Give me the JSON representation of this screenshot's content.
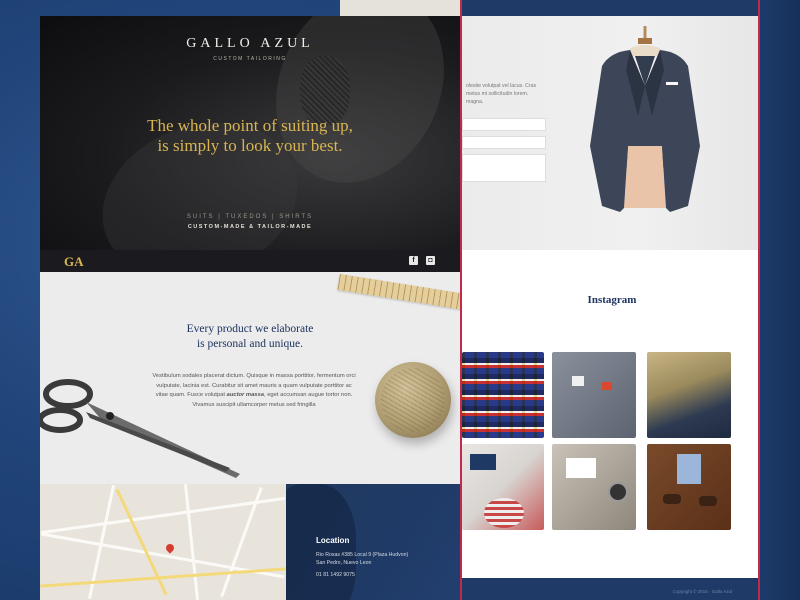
{
  "hero": {
    "brand": "GALLO AZUL",
    "brand_sub": "CUSTOM TAILORING",
    "headline_1": "The whole point of suiting up,",
    "headline_2": "is simply to look your best.",
    "tags": "SUITS  |  TUXEDOS  |  SHIRTS",
    "tags_2": "CUSTOM-MADE & TAILOR-MADE"
  },
  "navbar": {
    "logo": "GA",
    "facebook": "f",
    "instagram": "◘"
  },
  "product": {
    "title_1": "Every product we elaborate",
    "title_2": "is personal and unique.",
    "body_1": "Vestibulum sodales placerat dictum. Quisque in massa porttitor, fermentum orci",
    "body_2": "vulputate, lacinia est. Curabitur sit amet mauris a quam vulputate porttitor ac",
    "body_3a": "vitae quam. Fusce volutpat ",
    "body_3b": "auctor massa",
    "body_3c": ", eget accumsan augue tortor non.",
    "body_4": "Vivamus suscipit ullamcorper metus sed fringilla"
  },
  "location": {
    "title": "Location",
    "address_1": "Rio Rosas #385 Local 9 (Plaza Hudvon)",
    "address_2": "San Pedro, Nuevo Leon",
    "phone": "01 81 1492 9075"
  },
  "contact": {
    "text_1": "olestie volutpat vel lacus. Cras",
    "text_2": "metus mi sollicitudin lorem.",
    "text_3": "magna."
  },
  "instagram": {
    "title": "Instagram"
  },
  "footer": {
    "text": "Copyright © 2015 · Gallo Azul"
  },
  "colors": {
    "navy": "#1f3a66",
    "gold": "#d8b552",
    "accent_red": "#c3294a"
  }
}
